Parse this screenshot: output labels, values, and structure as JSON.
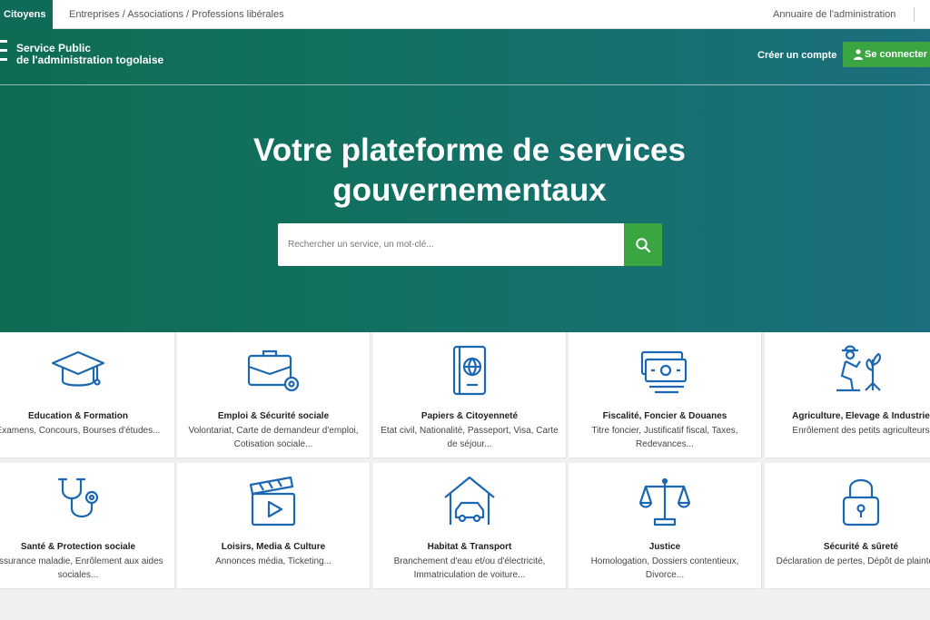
{
  "topbar": {
    "active_tab": "Citoyens",
    "tab_other": "Entreprises / Associations / Professions libérales",
    "directory_link": "Annuaire de l'administration"
  },
  "header": {
    "brand_line1": "Service Public",
    "brand_line2": "de l'administration togolaise",
    "create_account": "Créer un compte",
    "login": "Se connecter"
  },
  "hero": {
    "title_line1": "Votre plateforme de services",
    "title_line2": "gouvernementaux",
    "search_placeholder": "Rechercher un service, un mot-clé..."
  },
  "colors": {
    "brand_green": "#0f6a5a",
    "accent_green": "#3aa541",
    "icon_blue": "#1c67b3"
  },
  "categories": [
    {
      "icon": "graduation-cap-icon",
      "title": "Education & Formation",
      "desc": "Examens, Concours, Bourses d'études..."
    },
    {
      "icon": "briefcase-icon",
      "title": "Emploi & Sécurité sociale",
      "desc": "Volontariat, Carte de demandeur d'emploi, Cotisation sociale..."
    },
    {
      "icon": "passport-icon",
      "title": "Papiers & Citoyenneté",
      "desc": "Etat civil, Nationalité, Passeport, Visa, Carte de séjour..."
    },
    {
      "icon": "money-icon",
      "title": "Fiscalité, Foncier & Douanes",
      "desc": "Titre foncier, Justificatif fiscal, Taxes, Redevances..."
    },
    {
      "icon": "farmer-icon",
      "title": "Agriculture, Elevage & Industrie",
      "desc": "Enrôlement des petits agriculteurs"
    },
    {
      "icon": "stethoscope-icon",
      "title": "Santé & Protection sociale",
      "desc": "Assurance maladie, Enrôlement aux aides sociales..."
    },
    {
      "icon": "clapperboard-icon",
      "title": "Loisirs, Media & Culture",
      "desc": "Annonces média, Ticketing..."
    },
    {
      "icon": "house-car-icon",
      "title": "Habitat & Transport",
      "desc": "Branchement d'eau et/ou d'électricité, Immatriculation de voiture..."
    },
    {
      "icon": "scales-icon",
      "title": "Justice",
      "desc": "Homologation, Dossiers contentieux, Divorce..."
    },
    {
      "icon": "padlock-icon",
      "title": "Sécurité & sûreté",
      "desc": "Déclaration de pertes, Dépôt de plaintes..."
    }
  ]
}
